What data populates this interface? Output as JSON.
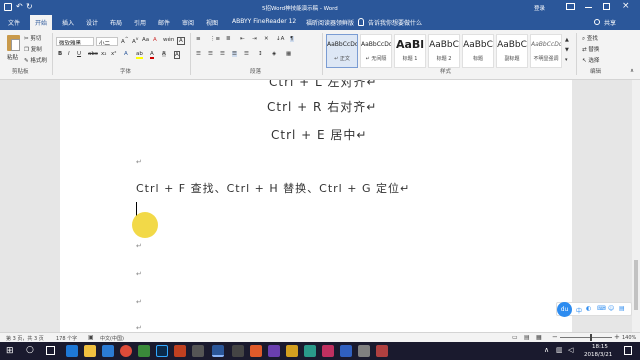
{
  "titlebar": {
    "title": "5招Word神技能演示稿 - Word",
    "login_label": "登录"
  },
  "menu": {
    "tabs": [
      "文件",
      "开始",
      "插入",
      "设计",
      "布局",
      "引用",
      "邮件",
      "审阅",
      "视图",
      "ABBYY FineReader 12",
      "福昕阅读器领鲜版"
    ],
    "active_tab": "开始",
    "tellme": "告诉我你想要做什么",
    "share": "共享"
  },
  "ribbon": {
    "clipboard": {
      "paste": "粘贴",
      "cut": "剪切",
      "copy": "复制",
      "format_painter": "格式刷",
      "label": "剪贴板"
    },
    "font": {
      "name": "微软雅黑",
      "size": "小二",
      "label": "字体"
    },
    "paragraph": {
      "label": "段落"
    },
    "styles": {
      "label": "样式",
      "items": [
        {
          "preview": "AaBbCcDd",
          "name": "↵ 正文"
        },
        {
          "preview": "AaBbCcDd",
          "name": "↵ 无间隔"
        },
        {
          "preview": "AaBl",
          "name": "标题 1"
        },
        {
          "preview": "AaBbC",
          "name": "标题 2"
        },
        {
          "preview": "AaBbC",
          "name": "标题"
        },
        {
          "preview": "AaBbC",
          "name": "副标题"
        },
        {
          "preview": "AaBbCcDd",
          "name": "不明显强调"
        }
      ]
    },
    "editing": {
      "find": "查找",
      "replace": "替换",
      "select": "选择",
      "label": "编辑"
    }
  },
  "document": {
    "lines": [
      "Ctrl + L 左对齐↵",
      "Ctrl + R 右对齐↵",
      "Ctrl + E  居中↵",
      "Ctrl + F 查找、Ctrl + H 替换、Ctrl + G 定位↵"
    ],
    "paragraph_mark": "↵"
  },
  "statusbar": {
    "page": "第 3 页，共 3 页",
    "words": "178 个字",
    "language": "中文(中国)",
    "zoom": "140%"
  },
  "ime": {
    "logo": "du",
    "lang": "中"
  },
  "taskbar": {
    "time": "18:15",
    "date": "2018/3/21"
  }
}
